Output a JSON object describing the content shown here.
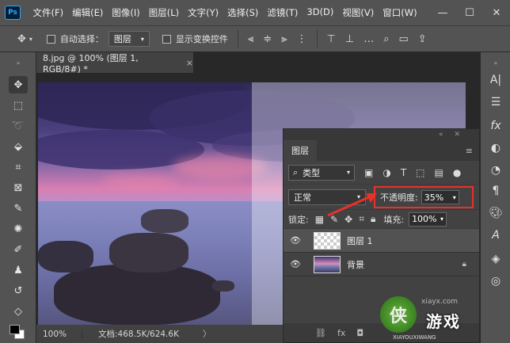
{
  "app": {
    "logo": "Ps"
  },
  "menu": [
    "文件(F)",
    "编辑(E)",
    "图像(I)",
    "图层(L)",
    "文字(Y)",
    "选择(S)",
    "滤镜(T)",
    "3D(D)",
    "视图(V)",
    "窗口(W)"
  ],
  "window_controls": {
    "minimize": "—",
    "maximize": "☐",
    "close": "✕"
  },
  "options": {
    "auto_select_label": "自动选择：",
    "auto_select_value": "图层",
    "show_transform_label": "显示变换控件"
  },
  "document": {
    "tab_title": "8.jpg @ 100% (图层 1, RGB/8#) *",
    "tab_close": "×"
  },
  "status": {
    "zoom": "100%",
    "doc_info": "文档:468.5K/624.6K",
    "arrow": "〉"
  },
  "layers_panel": {
    "collapse": "«",
    "close": "✕",
    "tab": "图层",
    "menu": "≡",
    "kind_label": "类型",
    "blend_mode": "正常",
    "opacity_label": "不透明度:",
    "opacity_value": "35%",
    "lock_label": "锁定:",
    "fill_label": "填充:",
    "fill_value": "100%",
    "layers": [
      {
        "name": "图层 1",
        "selected": true,
        "thumb": "transparent"
      },
      {
        "name": "背景",
        "selected": false,
        "thumb": "photo",
        "locked": true
      }
    ],
    "footer": [
      "⛓",
      "fx",
      "◘"
    ]
  },
  "annotation": {
    "color": "#e8312c"
  },
  "watermark": {
    "url": "xiayx.com",
    "logo_char": "侠",
    "text": "游戏",
    "sub": "XIAYOUXIWANG"
  },
  "colors": {
    "menubar": "#535353",
    "panel": "#424242",
    "accent": "#31a8ff"
  },
  "icons": [
    "move-icon",
    "marquee-icon",
    "lasso-icon",
    "quick-select-icon",
    "crop-icon",
    "frame-icon",
    "eyedropper-icon",
    "healing-icon",
    "brush-icon",
    "stamp-icon",
    "history-brush-icon",
    "eraser-icon"
  ]
}
